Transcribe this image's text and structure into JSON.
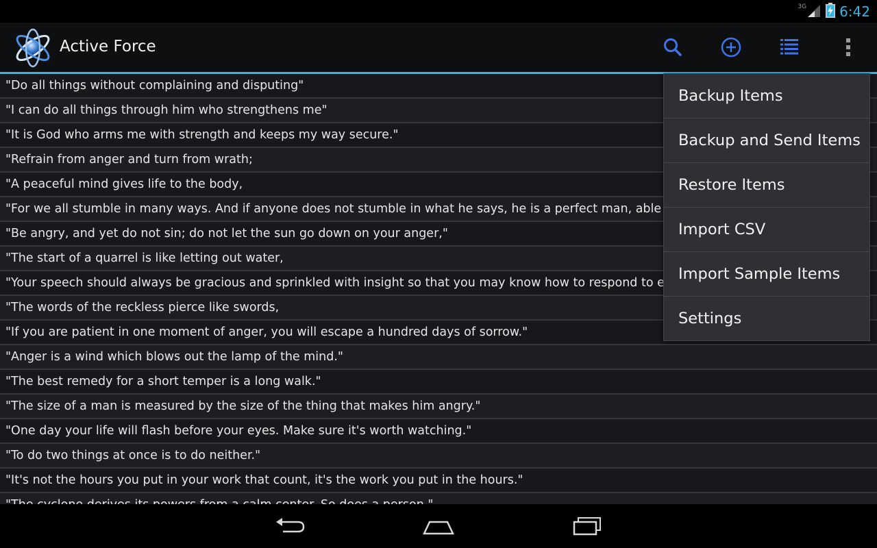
{
  "status_bar": {
    "network": "3G",
    "time": "6:42",
    "icons": [
      "signal-icon",
      "battery-charging-icon"
    ]
  },
  "action_bar": {
    "title": "Active Force",
    "logo": "atom-logo",
    "actions": [
      "search-icon",
      "add-circle-icon",
      "list-icon",
      "overflow-menu-icon"
    ],
    "accent_color": "#33b5e5"
  },
  "items": [
    "\"Do all things without complaining and disputing\"",
    "\"I can do all things through him who strengthens me\"",
    "\"It is God who arms me with strength and keeps my way secure.\"",
    "\"Refrain from anger and turn from wrath;",
    "\"A peaceful mind gives life to the body,",
    "\"For we all stumble in many ways. And if anyone does not stumble in what he says, he is a perfect man, able also",
    "\"Be angry, and yet do not sin; do not let the sun go down on your anger,\"",
    "\"The start of a quarrel is like letting out water,",
    "\"Your speech should always be gracious and sprinkled with insight so that you may know how to respond to eve",
    "\"The words of the reckless pierce like swords,",
    "\"If you are patient in one moment of anger, you will escape a hundred days of sorrow.\"",
    "\"Anger is a wind which blows out the lamp of the mind.\"",
    "\"The best remedy for a short temper is a long walk.\"",
    "\"The size of a man is measured by the size of the thing that makes him angry.\"",
    "\"One day your life will flash before your eyes. Make sure it's worth watching.\"",
    "\"To do two things at once is to do neither.\"",
    "\"It's not the hours you put in your work that count, it's the work you put in the hours.\"",
    "\"The cyclone derives its powers from a calm center. So does a person.\""
  ],
  "menu": [
    "Backup Items",
    "Backup and Send Items",
    "Restore Items",
    "Import CSV",
    "Import Sample Items",
    "Settings"
  ],
  "nav_bar": [
    "back-icon",
    "home-icon",
    "recent-apps-icon"
  ]
}
